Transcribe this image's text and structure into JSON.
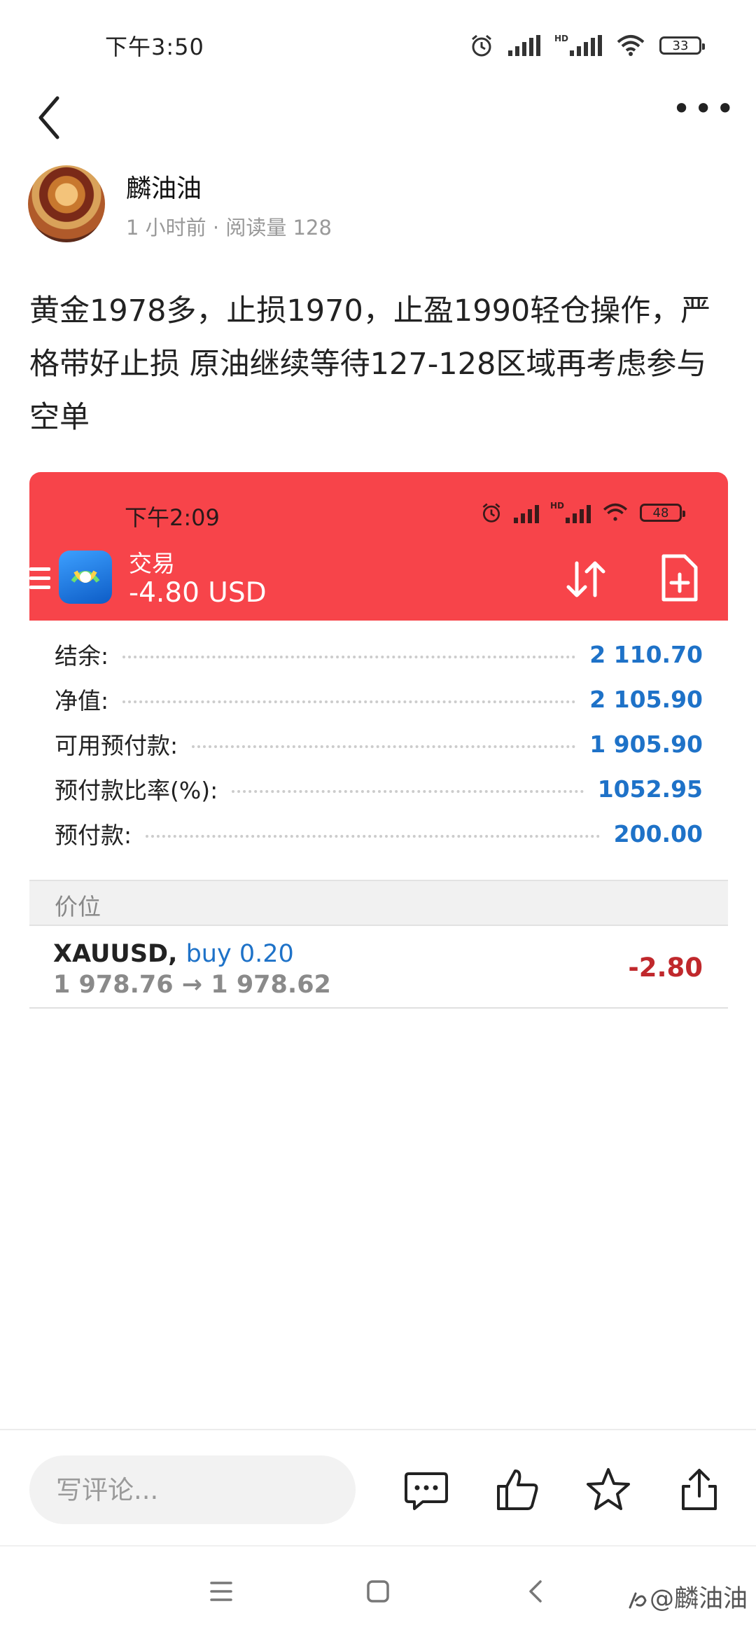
{
  "status_bar": {
    "time": "下午3:50",
    "battery": "33",
    "hd": "HD"
  },
  "nav": {
    "more_label": "•••"
  },
  "author": {
    "name": "麟油油",
    "meta": "1 小时前 · 阅读量 128"
  },
  "post": {
    "text": "黄金1978多，止损1970，止盈1990轻仓操作，严格带好止损 原油继续等待127-128区域再考虑参与空单"
  },
  "embed": {
    "status_time": "下午2:09",
    "battery": "48",
    "hd": "HD",
    "app_title": "交易",
    "profit": "-4.80 USD",
    "account_rows": [
      {
        "label": "结余:",
        "value": "2 110.70"
      },
      {
        "label": "净值:",
        "value": "2 105.90"
      },
      {
        "label": "可用预付款:",
        "value": "1 905.90"
      },
      {
        "label": "预付款比率(%):",
        "value": "1052.95"
      },
      {
        "label": "预付款:",
        "value": "200.00"
      }
    ],
    "section_label": "价位",
    "position": {
      "symbol": "XAUUSD,",
      "side": "buy 0.20",
      "prices": "1 978.76 → 1 978.62",
      "pl": "-2.80"
    },
    "colors": {
      "header": "#f7444a",
      "value_blue": "#1e72c8",
      "loss_red": "#c0282c"
    }
  },
  "bottom_bar": {
    "comment_placeholder": "写评论...",
    "actions": [
      "comment-icon",
      "like-icon",
      "favorite-star-icon",
      "share-icon"
    ]
  },
  "watermark": "@麟油油"
}
